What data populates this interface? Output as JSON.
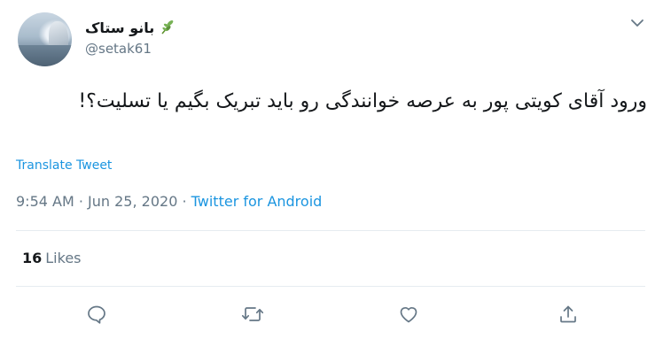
{
  "author": {
    "display_name": "بانو ستاک",
    "handle": "@setak61"
  },
  "tweet": {
    "text": "ورود آقای کویتی پور به عرصه خوانندگی رو باید تبریک بگیم یا تسلیت؟!",
    "translate_label": "Translate Tweet",
    "time": "9:54 AM",
    "separator": " · ",
    "date": "Jun 25, 2020",
    "source": "Twitter for Android"
  },
  "stats": {
    "likes_count": "16",
    "likes_label": "Likes"
  },
  "icons": {
    "name_emoji": "herb-icon",
    "menu": "chevron-down-icon",
    "actions": [
      "reply-icon",
      "retweet-icon",
      "like-icon",
      "share-icon"
    ]
  },
  "colors": {
    "link": "#1b95e0",
    "secondary_text": "#657786",
    "divider": "#e6ecf0"
  }
}
